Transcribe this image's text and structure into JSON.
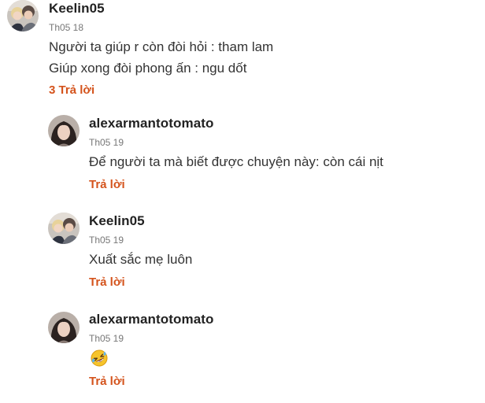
{
  "colors": {
    "accent": "#d4531c",
    "text": "#333333",
    "muted": "#777777"
  },
  "top_comment": {
    "username": "Keelin05",
    "timestamp": "Th05 18",
    "lines": [
      "Người ta giúp r còn đòi hỏi : tham lam",
      "Giúp xong đòi phong ấn : ngu dốt"
    ],
    "replies_link": "3 Trả lời",
    "avatar_icon": "avatar-photo-couple"
  },
  "replies": [
    {
      "username": "alexarmantotomato",
      "timestamp": "Th05 19",
      "text": "Để người ta mà biết được chuyện này: còn cái nịt",
      "reply_label": "Trả lời",
      "avatar_icon": "avatar-photo-dark-hair"
    },
    {
      "username": "Keelin05",
      "timestamp": "Th05 19",
      "text": "Xuất sắc mẹ luôn",
      "reply_label": "Trả lời",
      "avatar_icon": "avatar-photo-couple"
    },
    {
      "username": "alexarmantotomato",
      "timestamp": "Th05 19",
      "emoji": "rolling-on-floor-laughing-emoji",
      "reply_label": "Trả lời",
      "avatar_icon": "avatar-photo-dark-hair"
    }
  ]
}
